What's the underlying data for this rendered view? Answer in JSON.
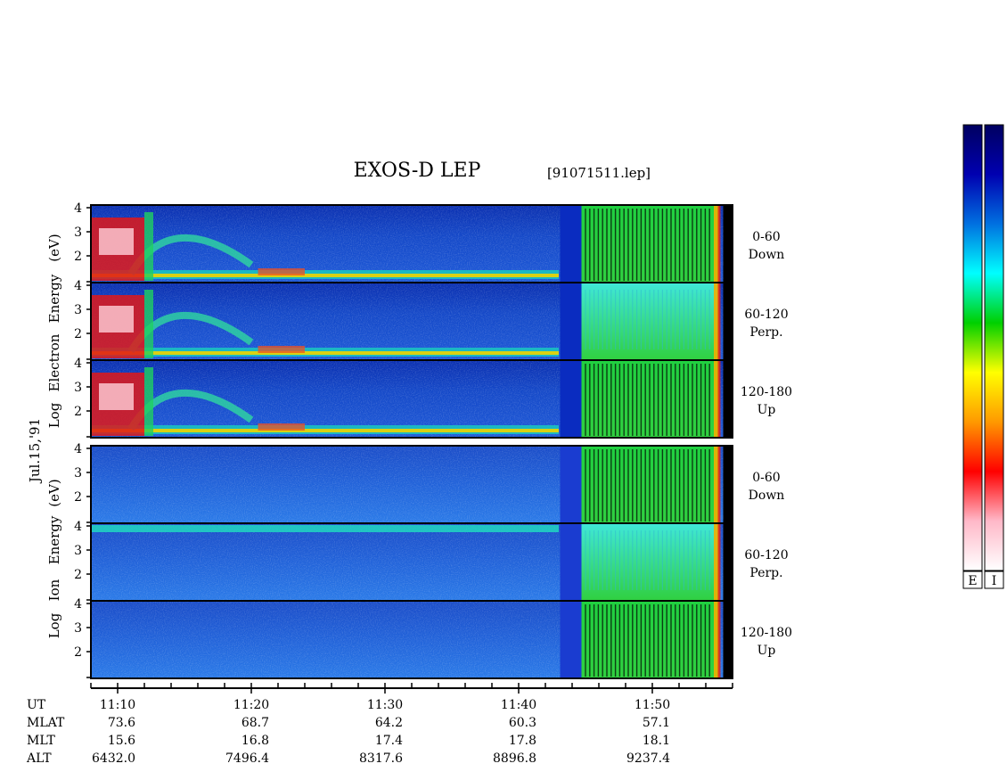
{
  "title": "EXOS-D LEP",
  "file_label": "[91071511.lep]",
  "date_label": "Jul.15,'91",
  "electron_label": [
    "Log",
    "Electron",
    "Energy",
    "(eV)"
  ],
  "ion_label": [
    "Log",
    "Ion",
    "Energy",
    "(eV)"
  ],
  "colorbar_labels": [
    "E",
    "I"
  ],
  "colorbar_colors": [
    "#ffffff",
    "#ffb8c8",
    "#ff0000",
    "#ff9900",
    "#ffff00",
    "#00d000",
    "#00ffff",
    "#0070e0",
    "#0000b0",
    "#000060"
  ],
  "chart_data": {
    "type": "heatmap",
    "ylim": [
      1,
      4
    ],
    "y_ticks": [
      "4",
      "3",
      "2"
    ],
    "panels": [
      {
        "species": "Electron",
        "channel": "0-60",
        "direction": "Down"
      },
      {
        "species": "Electron",
        "channel": "60-120",
        "direction": "Perp."
      },
      {
        "species": "Electron",
        "channel": "120-180",
        "direction": "Up"
      },
      {
        "species": "Ion",
        "channel": "0-60",
        "direction": "Down"
      },
      {
        "species": "Ion",
        "channel": "60-120",
        "direction": "Perp."
      },
      {
        "species": "Ion",
        "channel": "120-180",
        "direction": "Up"
      }
    ],
    "x_axis": {
      "range": [
        "11:08",
        "11:56"
      ],
      "row_labels": [
        "UT",
        "MLAT",
        "MLT",
        "ALT"
      ],
      "ticks": [
        {
          "ut": "11:10",
          "mlat": "73.6",
          "mlt": "15.6",
          "alt": "6432.0"
        },
        {
          "ut": "11:20",
          "mlat": "68.7",
          "mlt": "16.8",
          "alt": "7496.4"
        },
        {
          "ut": "11:30",
          "mlat": "64.2",
          "mlt": "17.4",
          "alt": "8317.6"
        },
        {
          "ut": "11:40",
          "mlat": "60.3",
          "mlt": "17.8",
          "alt": "8896.8"
        },
        {
          "ut": "11:50",
          "mlat": "57.1",
          "mlt": "18.1",
          "alt": "9237.4"
        }
      ]
    }
  }
}
